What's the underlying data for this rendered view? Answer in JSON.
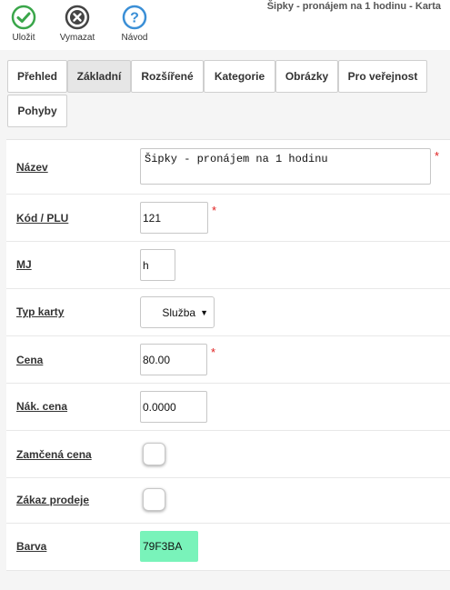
{
  "toolbar": {
    "save_label": "Uložit",
    "delete_label": "Vymazat",
    "help_label": "Návod",
    "save_color": "#3aa64a",
    "delete_color": "#444444",
    "help_color": "#3b8fd6",
    "save_icon": "check-circle-icon",
    "delete_icon": "x-circle-icon",
    "help_icon": "question-circle-icon"
  },
  "header": {
    "title": "Šipky - pronájem na 1 hodinu - Karta"
  },
  "tabs": [
    {
      "label": "Přehled",
      "active": false
    },
    {
      "label": "Základní",
      "active": true
    },
    {
      "label": "Rozšířené",
      "active": false
    },
    {
      "label": "Kategorie",
      "active": false
    },
    {
      "label": "Obrázky",
      "active": false
    },
    {
      "label": "Pro veřejnost",
      "active": false
    },
    {
      "label": "Pohyby",
      "active": false
    }
  ],
  "form": {
    "name": {
      "label": "Název",
      "value": "Šipky - pronájem na 1 hodinu",
      "required": true
    },
    "code": {
      "label": "Kód / PLU",
      "value": "121",
      "required": true
    },
    "unit": {
      "label": "MJ",
      "value": "h"
    },
    "card_type": {
      "label": "Typ karty",
      "value": "Služba"
    },
    "price": {
      "label": "Cena",
      "value": "80.00",
      "required": true
    },
    "purchase_price": {
      "label": "Nák. cena",
      "value": "0.0000"
    },
    "locked_price": {
      "label": "Zamčená cena",
      "checked": false
    },
    "sale_ban": {
      "label": "Zákaz prodeje",
      "checked": false
    },
    "color": {
      "label": "Barva",
      "value": "79F3BA",
      "swatch": "#79F3BA"
    }
  },
  "required_mark": "*"
}
